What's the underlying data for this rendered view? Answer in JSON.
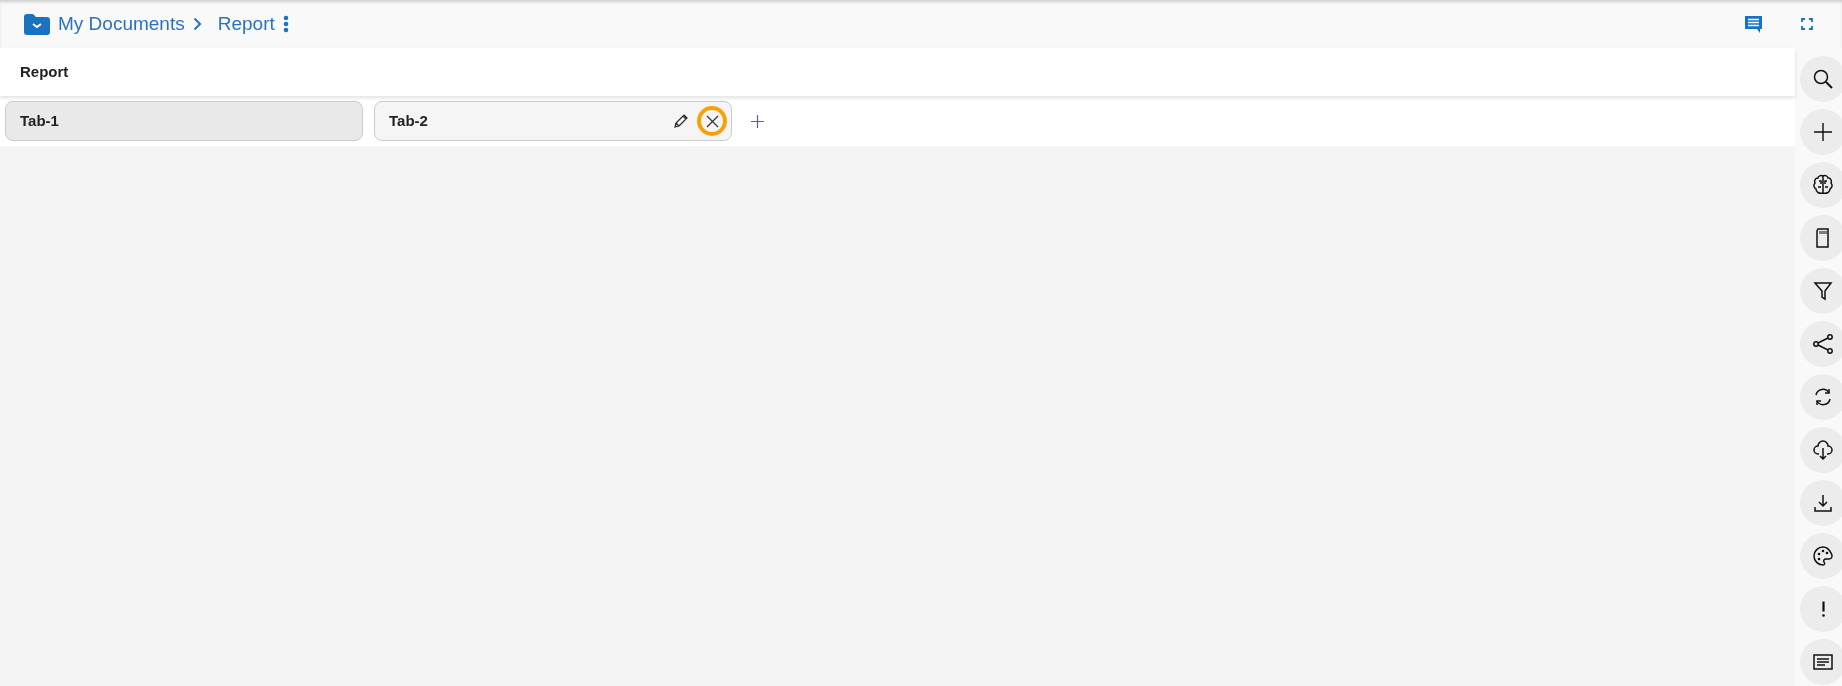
{
  "breadcrumb": {
    "folder": "My Documents",
    "current": "Report"
  },
  "report_title": "Report",
  "tabs": [
    {
      "label": "Tab-1",
      "selected": false
    },
    {
      "label": "Tab-2",
      "selected": true,
      "close_highlighted": true
    }
  ]
}
